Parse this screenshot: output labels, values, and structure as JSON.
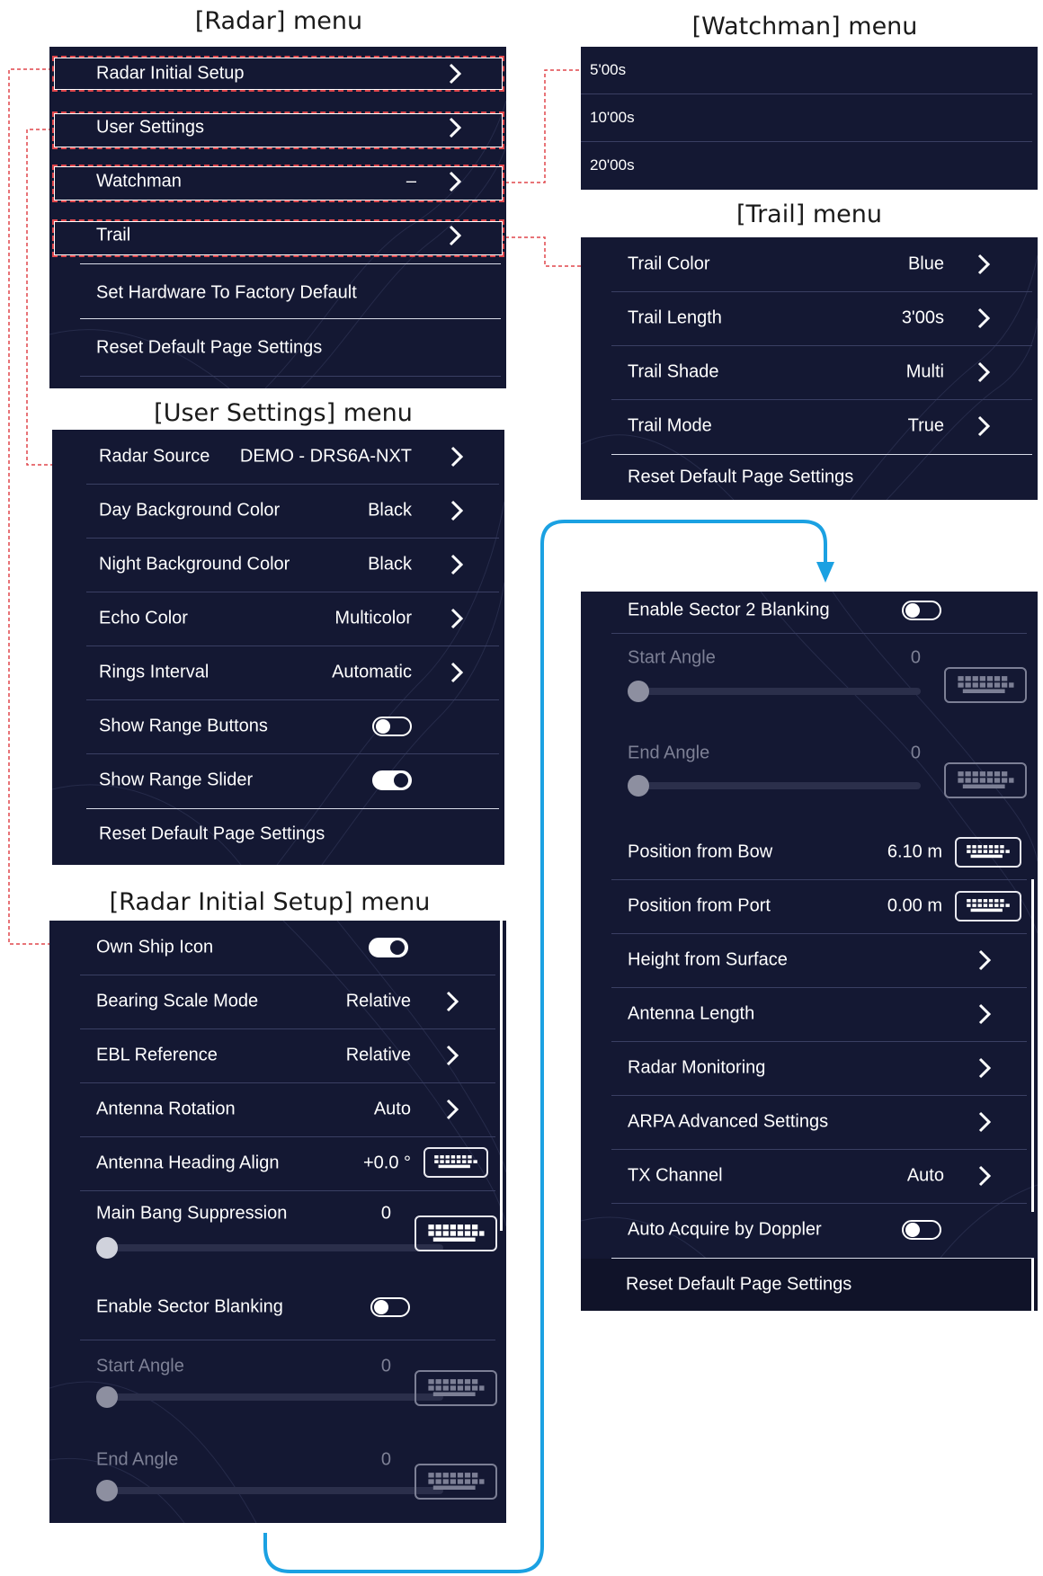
{
  "captions": {
    "radar": "[Radar] menu",
    "watchman": "[Watchman] menu",
    "trail": "[Trail] menu",
    "user_settings": "[User Settings] menu",
    "initial_setup": "[Radar Initial Setup] menu"
  },
  "radar_menu": {
    "items": [
      {
        "label": "Radar Initial Setup"
      },
      {
        "label": "User Settings"
      },
      {
        "label": "Watchman",
        "value": "–"
      },
      {
        "label": "Trail"
      },
      {
        "label": "Set Hardware To Factory Default"
      },
      {
        "label": "Reset Default Page Settings"
      }
    ]
  },
  "watchman_menu": {
    "items": [
      "5'00s",
      "10'00s",
      "20'00s"
    ]
  },
  "trail_menu": {
    "items": [
      {
        "label": "Trail Color",
        "value": "Blue"
      },
      {
        "label": "Trail Length",
        "value": "3'00s"
      },
      {
        "label": "Trail Shade",
        "value": "Multi"
      },
      {
        "label": "Trail Mode",
        "value": "True"
      },
      {
        "label": "Reset Default Page Settings"
      }
    ]
  },
  "user_settings_menu": {
    "items": [
      {
        "label": "Radar Source",
        "value": "DEMO - DRS6A-NXT"
      },
      {
        "label": "Day Background Color",
        "value": "Black"
      },
      {
        "label": "Night Background Color",
        "value": "Black"
      },
      {
        "label": "Echo Color",
        "value": "Multicolor"
      },
      {
        "label": "Rings Interval",
        "value": "Automatic"
      },
      {
        "label": "Show Range Buttons",
        "toggle": "off"
      },
      {
        "label": "Show Range Slider",
        "toggle": "on"
      },
      {
        "label": "Reset Default Page Settings"
      }
    ]
  },
  "initial_setup_menu": {
    "own_ship_icon": {
      "label": "Own Ship Icon",
      "toggle": "on"
    },
    "bearing_scale_mode": {
      "label": "Bearing Scale Mode",
      "value": "Relative"
    },
    "ebl_reference": {
      "label": "EBL Reference",
      "value": "Relative"
    },
    "antenna_rotation": {
      "label": "Antenna Rotation",
      "value": "Auto"
    },
    "antenna_heading_align": {
      "label": "Antenna Heading Align",
      "value": "+0.0 °"
    },
    "main_bang_suppression": {
      "label": "Main Bang Suppression",
      "value": "0",
      "level": 0
    },
    "enable_sector_blanking": {
      "label": "Enable Sector Blanking",
      "toggle": "off"
    },
    "start_angle": {
      "label": "Start Angle",
      "value": "0",
      "level": 0
    },
    "end_angle": {
      "label": "End Angle",
      "value": "0",
      "level": 0
    }
  },
  "initial_setup_cont": {
    "enable_sector2_blanking": {
      "label": "Enable Sector 2 Blanking",
      "toggle": "off"
    },
    "start_angle": {
      "label": "Start Angle",
      "value": "0",
      "level": 0
    },
    "end_angle": {
      "label": "End Angle",
      "value": "0",
      "level": 0
    },
    "position_from_bow": {
      "label": "Position from Bow",
      "value": "6.10 m"
    },
    "position_from_port": {
      "label": "Position from Port",
      "value": "0.00 m"
    },
    "height_from_surface": {
      "label": "Height from Surface"
    },
    "antenna_length": {
      "label": "Antenna Length"
    },
    "radar_monitoring": {
      "label": "Radar Monitoring"
    },
    "arpa_advanced": {
      "label": "ARPA Advanced Settings"
    },
    "tx_channel": {
      "label": "TX Channel",
      "value": "Auto"
    },
    "auto_acquire_doppler": {
      "label": "Auto Acquire by Doppler",
      "toggle": "off"
    },
    "reset": {
      "label": "Reset Default Page Settings"
    }
  },
  "colors": {
    "panel_bg": "#141833",
    "highlight": "#e0474c",
    "flow_arrow": "#1ba1e2"
  }
}
